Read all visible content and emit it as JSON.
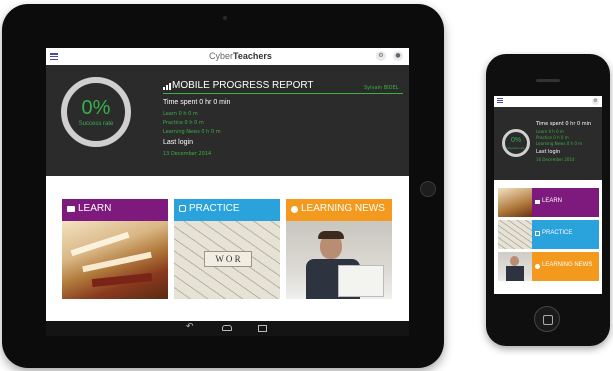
{
  "app": {
    "brand_light": "Cyber",
    "brand_bold": "Teachers"
  },
  "report": {
    "title": "MOBILE PROGRESS REPORT",
    "user": "Sylvain BIDEL",
    "success_value": "0%",
    "success_label": "Success rate",
    "time_spent": "Time spent 0 hr 0 min",
    "learn_time": "Learn 0 h 0 m",
    "practice_time": "Practice 0 h 0 m",
    "news_time": "Learning News 0 h 0 m",
    "last_login_label": "Last login",
    "last_login_date": "13 December 2014"
  },
  "phone_report": {
    "time_spent": "Time spent 0 hr 0 min",
    "learn_time": "Learn 0 h 0 m",
    "practice_time": "Practice 0 h 0 m",
    "news_time": "Learning News 0 h 0 m",
    "last_login_label": "Last login",
    "last_login_date": "16 December 2014"
  },
  "modules": [
    {
      "label": "LEARN",
      "color": "#7e1a7e"
    },
    {
      "label": "PRACTICE",
      "color": "#2aa3dd"
    },
    {
      "label": "LEARNING NEWS",
      "color": "#f39a1e"
    }
  ],
  "icons": {
    "menu": "menu-icon",
    "settings": "settings-icon",
    "profile": "profile-icon",
    "back": "back-icon",
    "home": "home-icon",
    "recent": "recent-apps-icon"
  }
}
